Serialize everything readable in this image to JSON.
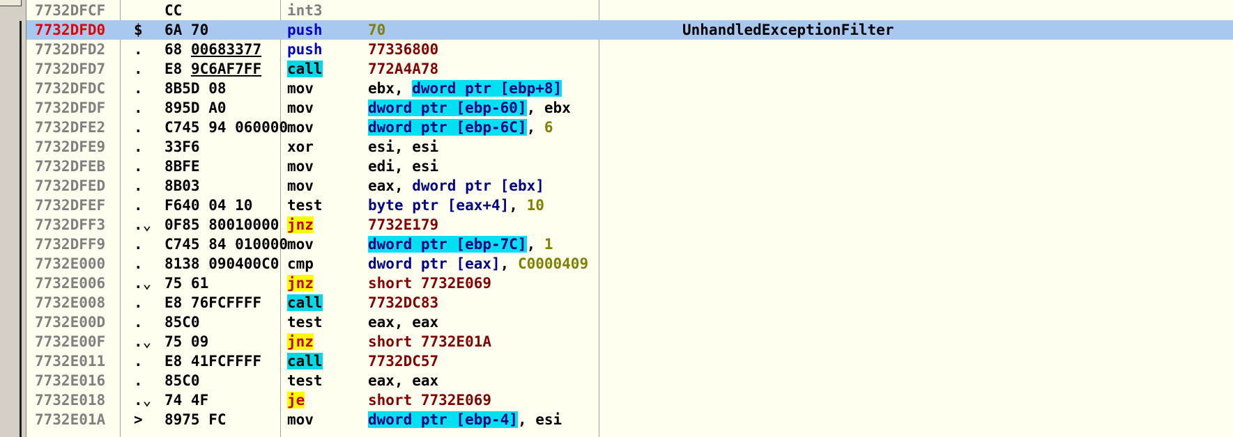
{
  "rows": [
    {
      "addr": "7732DFCF",
      "jump": "",
      "hex": "CC",
      "mnemonic": "int3",
      "mclass": "int3",
      "ops": [],
      "comment": ""
    },
    {
      "addr": "7732DFD0",
      "jump": "$",
      "hex": "6A 70",
      "mnemonic": "push",
      "mclass": "push",
      "selected": true,
      "ops": [
        {
          "t": "70",
          "c": "imm"
        }
      ],
      "comment": "UnhandledExceptionFilter"
    },
    {
      "addr": "7732DFD2",
      "jump": ".",
      "hex": "68 00683377",
      "hex_underline": "00683377",
      "mnemonic": "push",
      "mclass": "push",
      "ops": [
        {
          "t": "77336800",
          "c": "addr"
        }
      ],
      "comment": ""
    },
    {
      "addr": "7732DFD7",
      "jump": ".",
      "hex": "E8 9C6AF7FF",
      "hex_underline": "9C6AF7FF",
      "mnemonic": "call",
      "mclass": "call",
      "ops": [
        {
          "t": "772A4A78",
          "c": "addr"
        }
      ],
      "comment": ""
    },
    {
      "addr": "7732DFDC",
      "jump": ".",
      "hex": "8B5D 08",
      "mnemonic": "mov",
      "mclass": "plain",
      "ops": [
        {
          "t": "ebx",
          "c": "reg"
        },
        {
          "t": ", ",
          "c": "punc"
        },
        {
          "t": "dword ptr [ebp+8]",
          "c": "hl"
        }
      ],
      "comment": ""
    },
    {
      "addr": "7732DFDF",
      "jump": ".",
      "hex": "895D A0",
      "mnemonic": "mov",
      "mclass": "plain",
      "ops": [
        {
          "t": "dword ptr [ebp-60]",
          "c": "hl"
        },
        {
          "t": ", ",
          "c": "punc"
        },
        {
          "t": "ebx",
          "c": "reg"
        }
      ],
      "comment": ""
    },
    {
      "addr": "7732DFE2",
      "jump": ".",
      "hex": "C745 94 060000",
      "mnemonic": "mov",
      "mclass": "plain",
      "ops": [
        {
          "t": "dword ptr [ebp-6C]",
          "c": "hl"
        },
        {
          "t": ", ",
          "c": "punc"
        },
        {
          "t": "6",
          "c": "imm"
        }
      ],
      "comment": ""
    },
    {
      "addr": "7732DFE9",
      "jump": ".",
      "hex": "33F6",
      "mnemonic": "xor",
      "mclass": "plain",
      "ops": [
        {
          "t": "esi, esi",
          "c": "reg"
        }
      ],
      "comment": ""
    },
    {
      "addr": "7732DFEB",
      "jump": ".",
      "hex": "8BFE",
      "mnemonic": "mov",
      "mclass": "plain",
      "ops": [
        {
          "t": "edi, esi",
          "c": "reg"
        }
      ],
      "comment": ""
    },
    {
      "addr": "7732DFED",
      "jump": ".",
      "hex": "8B03",
      "mnemonic": "mov",
      "mclass": "plain",
      "ops": [
        {
          "t": "eax",
          "c": "reg"
        },
        {
          "t": ", ",
          "c": "punc"
        },
        {
          "t": "dword ptr [ebx]",
          "c": "mem"
        }
      ],
      "comment": ""
    },
    {
      "addr": "7732DFEF",
      "jump": ".",
      "hex": "F640 04 10",
      "mnemonic": "test",
      "mclass": "plain",
      "ops": [
        {
          "t": "byte ptr [eax+4]",
          "c": "mem"
        },
        {
          "t": ", ",
          "c": "punc"
        },
        {
          "t": "10",
          "c": "imm"
        }
      ],
      "comment": ""
    },
    {
      "addr": "7732DFF3",
      "jump": ".⌄",
      "hex": "0F85 80010000",
      "mnemonic": "jnz",
      "mclass": "jcc",
      "ops": [
        {
          "t": "7732E179",
          "c": "addr"
        }
      ],
      "comment": ""
    },
    {
      "addr": "7732DFF9",
      "jump": ".",
      "hex": "C745 84 010000",
      "mnemonic": "mov",
      "mclass": "plain",
      "ops": [
        {
          "t": "dword ptr [ebp-7C]",
          "c": "hl"
        },
        {
          "t": ", ",
          "c": "punc"
        },
        {
          "t": "1",
          "c": "imm"
        }
      ],
      "comment": ""
    },
    {
      "addr": "7732E000",
      "jump": ".",
      "hex": "8138 090400C0",
      "mnemonic": "cmp",
      "mclass": "plain",
      "ops": [
        {
          "t": "dword ptr [eax]",
          "c": "mem"
        },
        {
          "t": ", ",
          "c": "punc"
        },
        {
          "t": "C0000409",
          "c": "imm"
        }
      ],
      "comment": ""
    },
    {
      "addr": "7732E006",
      "jump": ".⌄",
      "hex": "75 61",
      "mnemonic": "jnz",
      "mclass": "jcc",
      "ops": [
        {
          "t": "short 7732E069",
          "c": "addr"
        }
      ],
      "comment": ""
    },
    {
      "addr": "7732E008",
      "jump": ".",
      "hex": "E8 76FCFFFF",
      "mnemonic": "call",
      "mclass": "call",
      "ops": [
        {
          "t": "7732DC83",
          "c": "addr"
        }
      ],
      "comment": ""
    },
    {
      "addr": "7732E00D",
      "jump": ".",
      "hex": "85C0",
      "mnemonic": "test",
      "mclass": "plain",
      "ops": [
        {
          "t": "eax, eax",
          "c": "reg"
        }
      ],
      "comment": ""
    },
    {
      "addr": "7732E00F",
      "jump": ".⌄",
      "hex": "75 09",
      "mnemonic": "jnz",
      "mclass": "jcc",
      "ops": [
        {
          "t": "short 7732E01A",
          "c": "addr"
        }
      ],
      "comment": ""
    },
    {
      "addr": "7732E011",
      "jump": ".",
      "hex": "E8 41FCFFFF",
      "mnemonic": "call",
      "mclass": "call",
      "ops": [
        {
          "t": "7732DC57",
          "c": "addr"
        }
      ],
      "comment": ""
    },
    {
      "addr": "7732E016",
      "jump": ".",
      "hex": "85C0",
      "mnemonic": "test",
      "mclass": "plain",
      "ops": [
        {
          "t": "eax, eax",
          "c": "reg"
        }
      ],
      "comment": ""
    },
    {
      "addr": "7732E018",
      "jump": ".⌄",
      "hex": "74 4F",
      "mnemonic": "je",
      "mclass": "jcc",
      "ops": [
        {
          "t": "short 7732E069",
          "c": "addr"
        }
      ],
      "comment": ""
    },
    {
      "addr": "7732E01A",
      "jump": ">",
      "hex": "8975 FC",
      "mnemonic": "mov",
      "mclass": "plain",
      "ops": [
        {
          "t": "dword ptr [ebp-4]",
          "c": "hl"
        },
        {
          "t": ", ",
          "c": "punc"
        },
        {
          "t": "esi",
          "c": "reg"
        }
      ],
      "comment": ""
    }
  ]
}
